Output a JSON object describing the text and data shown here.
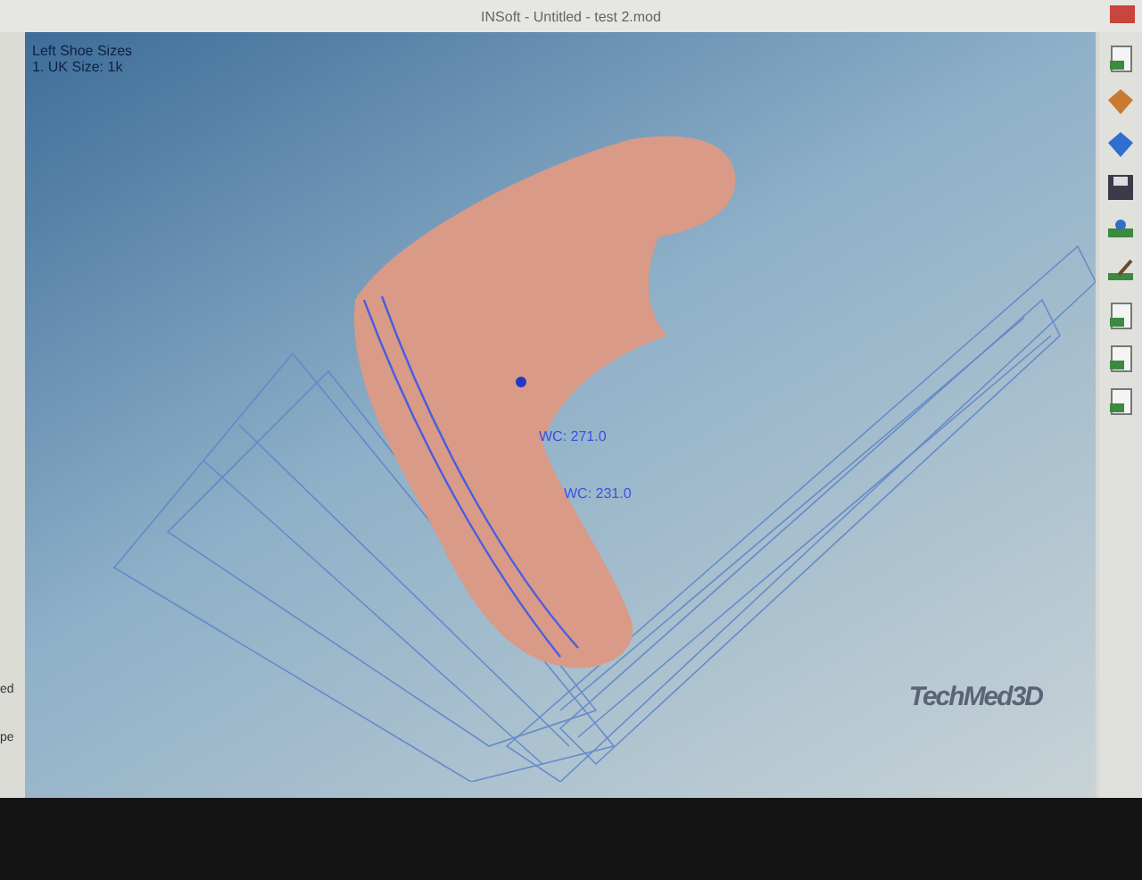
{
  "window": {
    "title": "INSoft - Untitled - test 2.mod"
  },
  "side_panel": {
    "texts": [
      "ed",
      "pe"
    ]
  },
  "viewport": {
    "info_lines": [
      "Left Shoe Sizes",
      "1. UK Size: 1k"
    ],
    "measurements": [
      "WC: 271.0",
      "WC: 231.0"
    ],
    "logo": "TechMed3D"
  }
}
